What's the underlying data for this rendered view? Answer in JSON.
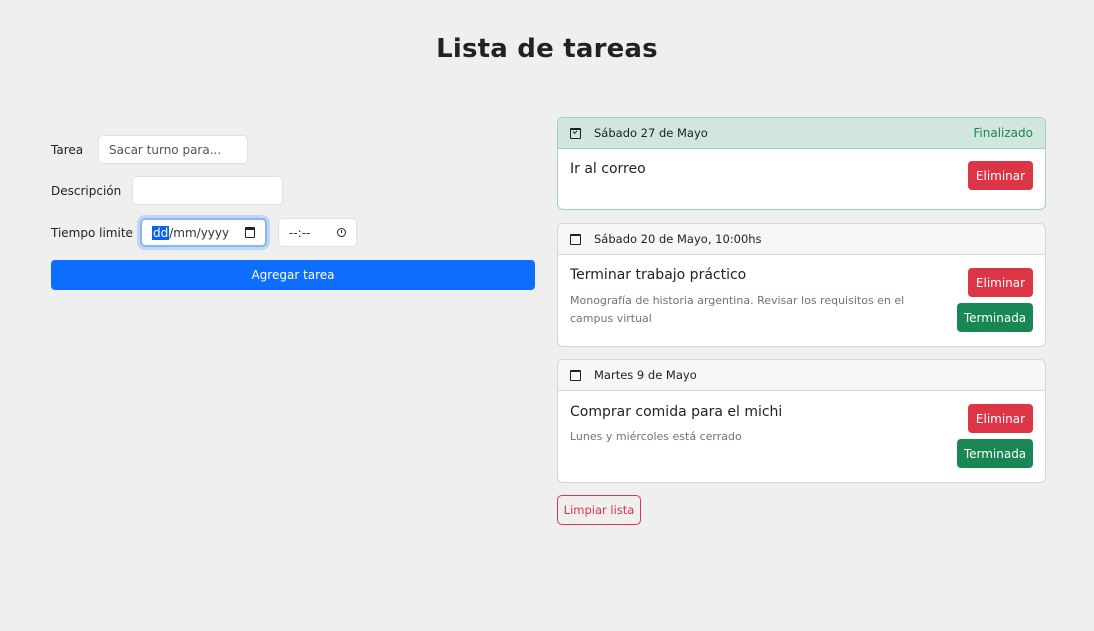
{
  "page": {
    "title": "Lista de tareas"
  },
  "form": {
    "task_label": "Tarea",
    "task_placeholder": "Sacar turno para...",
    "description_label": "Descripción",
    "deadline_label": "Tiempo limite",
    "date_segment_day": "dd",
    "date_segment_rest": "/mm/yyyy",
    "time_placeholder": "--:--",
    "add_button": "Agregar tarea"
  },
  "tasks": [
    {
      "date": "Sábado 27 de Mayo",
      "status": "Finalizado",
      "title": "Ir al correo",
      "description": "",
      "delete_label": "Eliminar"
    },
    {
      "date": "Sábado 20 de Mayo, 10:00hs",
      "status": "",
      "title": "Terminar trabajo práctico",
      "description": "Monografía de historia argentina. Revisar los requisitos en el campus virtual",
      "delete_label": "Eliminar",
      "done_label": "Terminada"
    },
    {
      "date": "Martes 9 de Mayo",
      "status": "",
      "title": "Comprar comida para el michi",
      "description": "Lunes y miércoles está cerrado",
      "delete_label": "Eliminar",
      "done_label": "Terminada"
    }
  ],
  "clear_button": "Limpiar lista",
  "colors": {
    "primary": "#0d6efd",
    "danger": "#dc3545",
    "success": "#198754",
    "done_header": "#d1e7dd",
    "background": "#efefef"
  }
}
